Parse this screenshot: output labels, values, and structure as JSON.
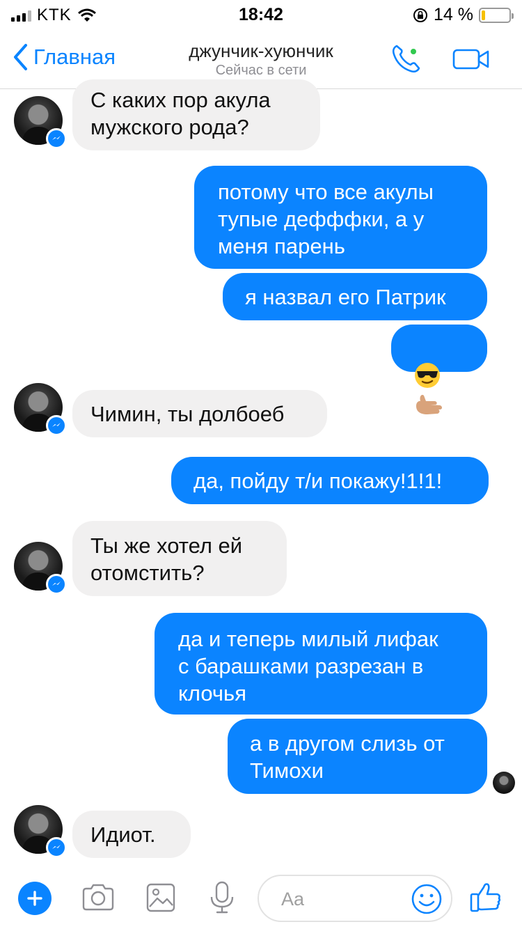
{
  "status_bar": {
    "carrier": "KTK",
    "time": "18:42",
    "battery_text": "14 %",
    "battery_level": 0.14
  },
  "nav": {
    "back_label": "Главная",
    "title": "джунчик-хуюнчик",
    "subtitle": "Сейчас в сети"
  },
  "messages": [
    {
      "dir": "in",
      "text": "С каких пор акула\nмужского рода?"
    },
    {
      "dir": "out",
      "text": "потому что все акулы\nтупые дефффки, а у\nменя парень"
    },
    {
      "dir": "out",
      "text": "я назвал его Патрик"
    },
    {
      "dir": "out",
      "text": "",
      "emojis": [
        "sunglasses-face",
        "call-me-hand"
      ]
    },
    {
      "dir": "in",
      "text": "Чимин, ты долбоеб"
    },
    {
      "dir": "out",
      "text": "да, пойду т/и покажу!1!1!"
    },
    {
      "dir": "in",
      "text": "Ты же хотел ей\nотомстить?"
    },
    {
      "dir": "out",
      "text": "да и теперь милый лифак\nс барашками разрезан в\nклочья"
    },
    {
      "dir": "out",
      "text": "а в другом слизь от\nТимохи"
    },
    {
      "dir": "in",
      "text": "Идиот."
    }
  ],
  "composer": {
    "placeholder": "Aa",
    "icons": [
      "plus-icon",
      "camera-icon",
      "gallery-icon",
      "microphone-icon",
      "smile-icon",
      "thumbs-up-icon"
    ]
  },
  "colors": {
    "accent": "#0a84ff",
    "outgoing_bubble": "#0b84ff",
    "incoming_bubble": "#f1f0f0",
    "online": "#31c94f",
    "battery": "#f6c000"
  }
}
